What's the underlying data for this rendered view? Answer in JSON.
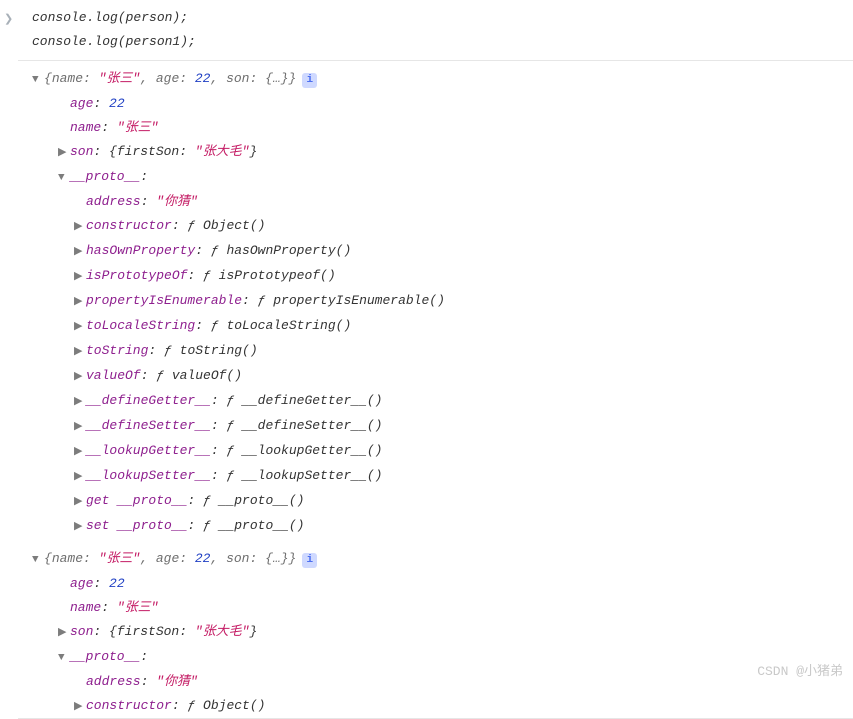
{
  "prompt_icon": "❯",
  "code": {
    "line1": "console.log(person);",
    "line2": "console.log(person1);"
  },
  "summary": {
    "open_brace": "{",
    "nameKey": "name:",
    "nameVal": " \"张三\"",
    "sep1": ", ",
    "ageKey": "age:",
    "ageVal": " 22",
    "sep2": ", ",
    "sonKey": "son:",
    "sonVal": " {…}",
    "close_brace": "}",
    "info_icon": "i"
  },
  "props": {
    "age_key": "age",
    "age_val": "22",
    "name_key": "name",
    "name_val": "\"张三\"",
    "son_key": "son",
    "son_val_open": "{firstSon: ",
    "son_val_str": "\"张大毛\"",
    "son_val_close": "}",
    "proto_key": "__proto__",
    "address_key": "address",
    "address_val": "\"你猜\"",
    "constructor_key": "constructor",
    "constructor_val": "Object()",
    "hasOwnProperty_key": "hasOwnProperty",
    "hasOwnProperty_val": "hasOwnProperty()",
    "isPrototypeOf_key": "isPrototypeOf",
    "isPrototypeOf_val": "isPrototypeof()",
    "propertyIsEnumerable_key": "propertyIsEnumerable",
    "propertyIsEnumerable_val": "propertyIsEnumerable()",
    "toLocaleString_key": "toLocaleString",
    "toLocaleString_val": "toLocaleString()",
    "toString_key": "toString",
    "toString_val": "toString()",
    "valueOf_key": "valueOf",
    "valueOf_val": "valueOf()",
    "defineGetter_key": "__defineGetter__",
    "defineGetter_val": "__defineGetter__()",
    "defineSetter_key": "__defineSetter__",
    "defineSetter_val": "__defineSetter__()",
    "lookupGetter_key": "__lookupGetter__",
    "lookupGetter_val": "__lookupGetter__()",
    "lookupSetter_key": "__lookupSetter__",
    "lookupSetter_val": "__lookupSetter__()",
    "get_proto_key": "get __proto__",
    "get_proto_val": "__proto__()",
    "set_proto_key": "set __proto__",
    "set_proto_val": "__proto__()",
    "f_sym": "ƒ ",
    "colon_sp": ": "
  },
  "watermark": "CSDN @小猪弟"
}
